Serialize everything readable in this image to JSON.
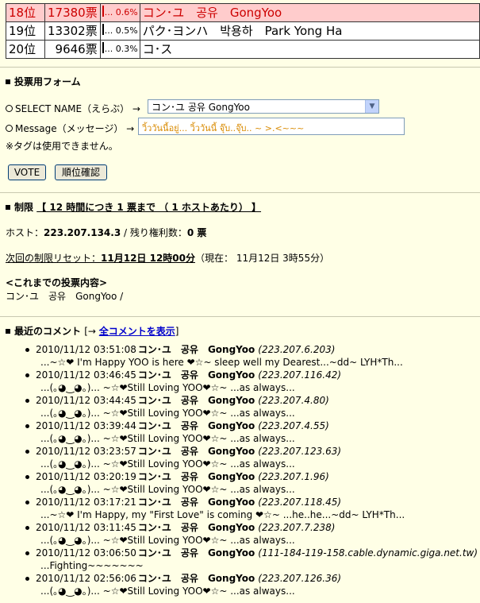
{
  "ranking": [
    {
      "rank": "18位",
      "votes": "17380票",
      "pct": "... 0.6%",
      "name": "コン･ユ　공유　GongYoo",
      "highlight": true
    },
    {
      "rank": "19位",
      "votes": "13302票",
      "pct": "... 0.5%",
      "name": "パク･ヨンハ　박용하　Park Yong Ha",
      "highlight": false
    },
    {
      "rank": "20位",
      "votes": "9646票",
      "pct": "... 0.3%",
      "name": "コ･ス",
      "highlight": false
    }
  ],
  "form": {
    "title": "投票用フォーム",
    "select_label": "SELECT NAME（えらぶ） →",
    "select_value": "コン･ユ 공유 GongYoo",
    "message_label": "Message（メッセージ） →",
    "message_value": "วิ้ววันนี้อยู่... วิ้ววันนี้ จุ๊บ..จุ๊บ..  ~ >.<~~~",
    "note": "※タグは使用できません。",
    "vote_button": "VOTE",
    "rank_button": "順位確認"
  },
  "limit": {
    "title_prefix": "制限",
    "title_rule": "【 12 時間につき 1 票まで （ 1 ホストあたり） 】",
    "host_label": "ホスト：",
    "host_value": "223.207.134.3",
    "remaining_label": " / 残り権利数：",
    "remaining_value": "0 票",
    "reset_label": "次回の制限リセット：",
    "reset_value": "11月12日 12時00分",
    "now_text": "（現在： 11月12日 3時55分）",
    "history_title": "<これまでの投票内容>",
    "history_value": "コン･ユ　공유　GongYoo /"
  },
  "comments_section": {
    "title": "最近のコメント",
    "bracket_open": "[→ ",
    "show_all": "全コメントを表示",
    "bracket_close": "]"
  },
  "comments": [
    {
      "time": "2010/11/12 03:51:08",
      "name": "コン･ユ　공유　GongYoo",
      "ip": "(223.207.6.203)",
      "msg": "...~☆❤ I'm Happy YOO is here ❤☆~ sleep well my Dearest...~dd~ LYH*Th..."
    },
    {
      "time": "2010/11/12 03:46:45",
      "name": "コン･ユ　공유　GongYoo",
      "ip": "(223.207.116.42)",
      "msg": "...(｡◕‿◕｡)... ~☆❤Still Loving YOO❤☆~ ...as always..."
    },
    {
      "time": "2010/11/12 03:44:45",
      "name": "コン･ユ　공유　GongYoo",
      "ip": "(223.207.4.80)",
      "msg": "...(｡◕‿◕｡)... ~☆❤Still Loving YOO❤☆~ ...as always..."
    },
    {
      "time": "2010/11/12 03:39:44",
      "name": "コン･ユ　공유　GongYoo",
      "ip": "(223.207.4.55)",
      "msg": "...(｡◕‿◕｡)... ~☆❤Still Loving YOO❤☆~ ...as always..."
    },
    {
      "time": "2010/11/12 03:23:57",
      "name": "コン･ユ　공유　GongYoo",
      "ip": "(223.207.123.63)",
      "msg": "...(｡◕‿◕｡)... ~☆❤Still Loving YOO❤☆~ ...as always..."
    },
    {
      "time": "2010/11/12 03:20:19",
      "name": "コン･ユ　공유　GongYoo",
      "ip": "(223.207.1.96)",
      "msg": "...(｡◕‿◕｡)... ~☆❤Still Loving YOO❤☆~ ...as always..."
    },
    {
      "time": "2010/11/12 03:17:21",
      "name": "コン･ユ　공유　GongYoo",
      "ip": "(223.207.118.45)",
      "msg": "...~☆❤ I'm Happy, my \"First Love\" is coming ❤☆~ ...he..he...~dd~ LYH*Th..."
    },
    {
      "time": "2010/11/12 03:11:45",
      "name": "コン･ユ　공유　GongYoo",
      "ip": "(223.207.7.238)",
      "msg": "...(｡◕‿◕｡)... ~☆❤Still Loving YOO❤☆~ ...as always..."
    },
    {
      "time": "2010/11/12 03:06:50",
      "name": "コン･ユ　공유　GongYoo",
      "ip": "(111-184-119-158.cable.dynamic.giga.net.tw)",
      "msg": "...Fighting~~~~~~~"
    },
    {
      "time": "2010/11/12 02:56:06",
      "name": "コン･ユ　공유　GongYoo",
      "ip": "(223.207.126.36)",
      "msg": "...(｡◕‿◕｡)... ~☆❤Still Loving YOO❤☆~ ...as always..."
    }
  ]
}
